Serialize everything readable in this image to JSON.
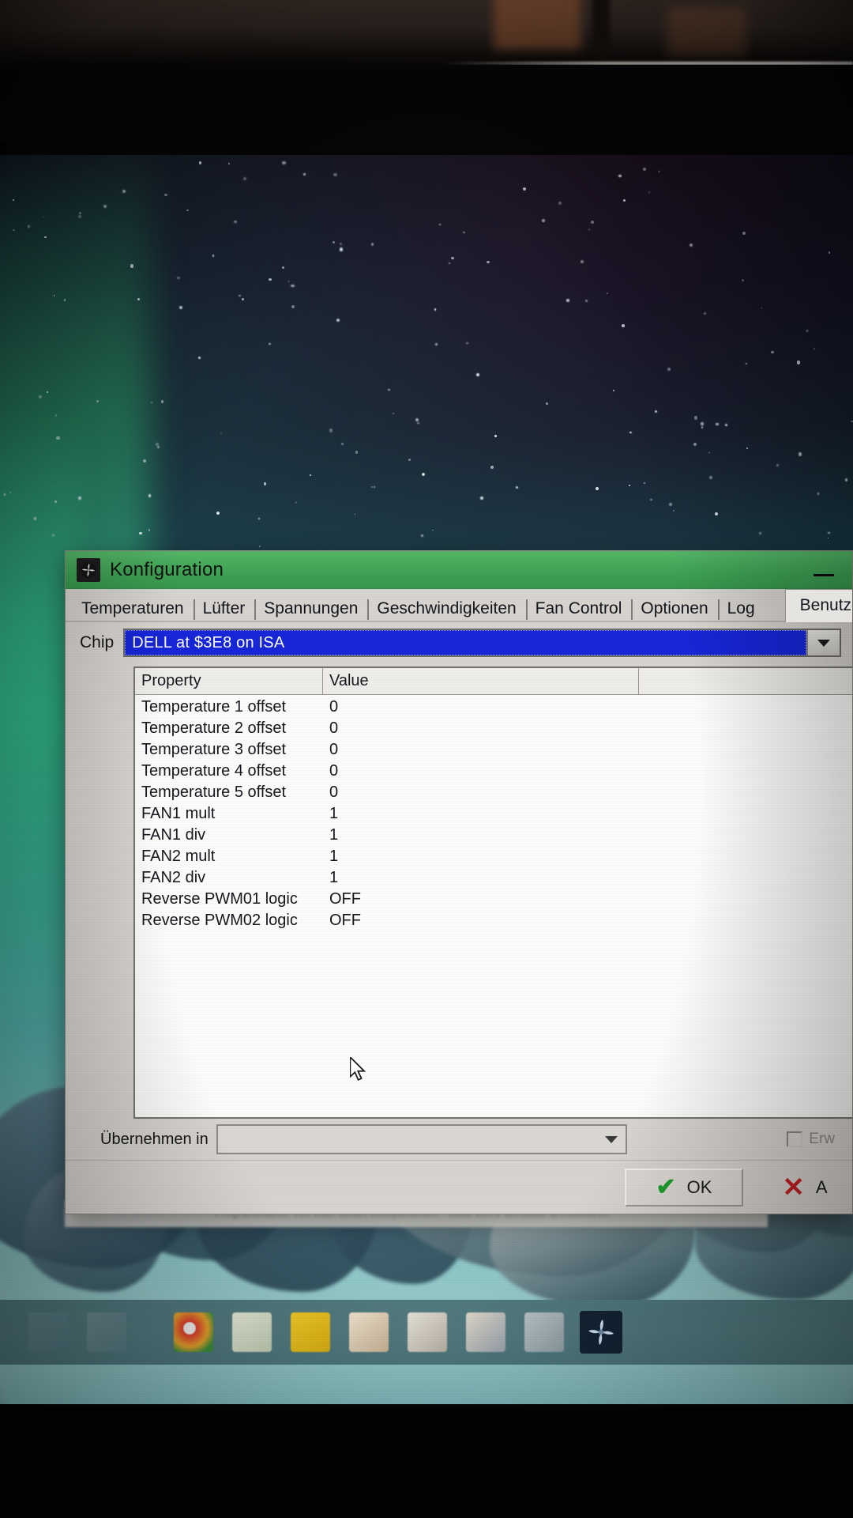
{
  "window": {
    "title": "Konfiguration",
    "title_icon": "fan-icon",
    "minimize_label": "—"
  },
  "tabs": [
    {
      "label": "Temperaturen",
      "active": false
    },
    {
      "label": "Lüfter",
      "active": false
    },
    {
      "label": "Spannungen",
      "active": false
    },
    {
      "label": "Geschwindigkeiten",
      "active": false
    },
    {
      "label": "Fan Control",
      "active": false
    },
    {
      "label": "Optionen",
      "active": false
    },
    {
      "label": "Log",
      "active": false
    },
    {
      "label": "Benutzerdefiniert",
      "active": true
    }
  ],
  "chip": {
    "label": "Chip",
    "selected_value": "DELL at $3E8 on ISA",
    "highlight_color": "#1726d8",
    "dropdown_icon": "chevron-down-icon"
  },
  "list": {
    "columns": [
      "Property",
      "Value",
      ""
    ],
    "rows": [
      {
        "property": "Temperature 1 offset",
        "value": "0"
      },
      {
        "property": "Temperature 2 offset",
        "value": "0"
      },
      {
        "property": "Temperature 3 offset",
        "value": "0"
      },
      {
        "property": "Temperature 4 offset",
        "value": "0"
      },
      {
        "property": "Temperature 5 offset",
        "value": "0"
      },
      {
        "property": "FAN1 mult",
        "value": "1"
      },
      {
        "property": "FAN1 div",
        "value": "1"
      },
      {
        "property": "FAN2 mult",
        "value": "1"
      },
      {
        "property": "FAN2 div",
        "value": "1"
      },
      {
        "property": "Reverse PWM01 logic",
        "value": "OFF"
      },
      {
        "property": "Reverse PWM02 logic",
        "value": "OFF"
      }
    ]
  },
  "apply": {
    "label": "Übernehmen in",
    "selected_value": "",
    "dropdown_icon": "chevron-down-icon",
    "checkbox_label": "Erw",
    "checkbox_checked": false
  },
  "buttons": {
    "ok_label": "OK",
    "ok_icon": "check-icon",
    "cancel_label": "A",
    "cancel_icon": "x-icon"
  },
  "desktop": {
    "behind_window_text": "Programmieren von Intel-Smart-Komponenten - eeee eerre  ahhaaue ahhaauueeh",
    "taskbar_icons": [
      "start-icon",
      "task-view-icon",
      "chrome-icon",
      "file-explorer-icon",
      "notes-icon",
      "store-icon",
      "mail-icon",
      "photos-icon",
      "generic-app-icon",
      "speedfan-icon"
    ]
  },
  "colors": {
    "titlebar_green": "#3fa455",
    "selection_blue": "#1726d8",
    "ok_check_green": "#1f9d2f",
    "cancel_x_red": "#c42222",
    "dialog_face": "#d8d5d0"
  }
}
